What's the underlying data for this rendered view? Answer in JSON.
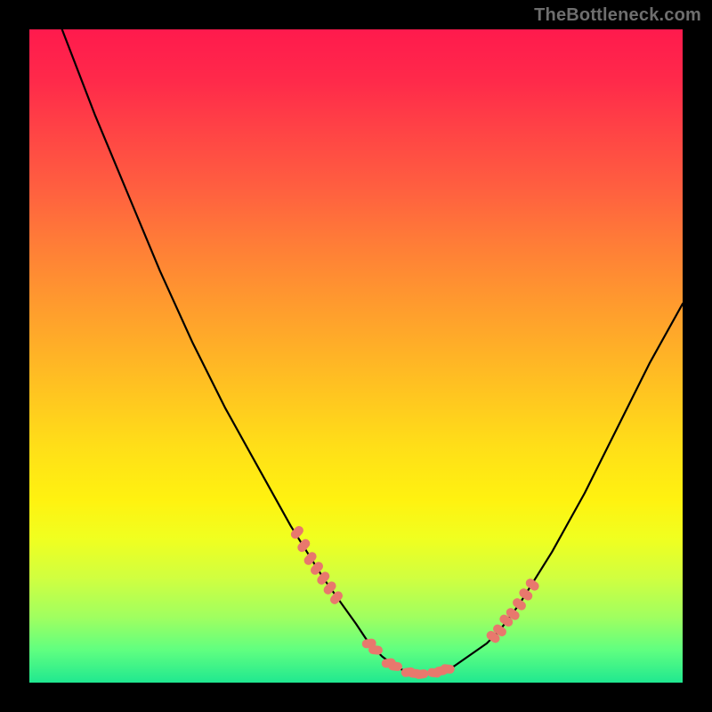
{
  "watermark": "TheBottleneck.com",
  "chart_data": {
    "type": "line",
    "title": "",
    "xlabel": "",
    "ylabel": "",
    "xlim": [
      0,
      100
    ],
    "ylim": [
      0,
      100
    ],
    "grid": false,
    "legend": false,
    "series": [
      {
        "name": "bottleneck-curve",
        "color": "#000000",
        "x": [
          5,
          10,
          15,
          20,
          25,
          30,
          35,
          40,
          45,
          50,
          52,
          54,
          56,
          58,
          60,
          62,
          65,
          70,
          72,
          75,
          80,
          85,
          90,
          95,
          100
        ],
        "y": [
          100,
          87,
          75,
          63,
          52,
          42,
          33,
          24,
          16,
          9,
          6,
          4,
          2.5,
          1.5,
          1.3,
          1.5,
          2.5,
          6,
          8,
          12,
          20,
          29,
          39,
          49,
          58
        ]
      }
    ],
    "markers": [
      {
        "name": "left-cluster",
        "color": "#e8786d",
        "x": [
          41,
          42,
          43,
          44,
          45,
          46,
          47
        ],
        "y": [
          23,
          21,
          19,
          17.5,
          16,
          14.5,
          13
        ]
      },
      {
        "name": "bottom-cluster",
        "color": "#e8786d",
        "x": [
          52,
          53,
          55,
          56,
          58,
          59,
          60,
          62,
          63,
          64
        ],
        "y": [
          6,
          5,
          3,
          2.5,
          1.6,
          1.4,
          1.3,
          1.5,
          1.8,
          2.1
        ]
      },
      {
        "name": "right-cluster",
        "color": "#e8786d",
        "x": [
          71,
          72,
          73,
          74,
          75,
          76,
          77
        ],
        "y": [
          7,
          8,
          9.5,
          10.5,
          12,
          13.5,
          15
        ]
      }
    ]
  }
}
